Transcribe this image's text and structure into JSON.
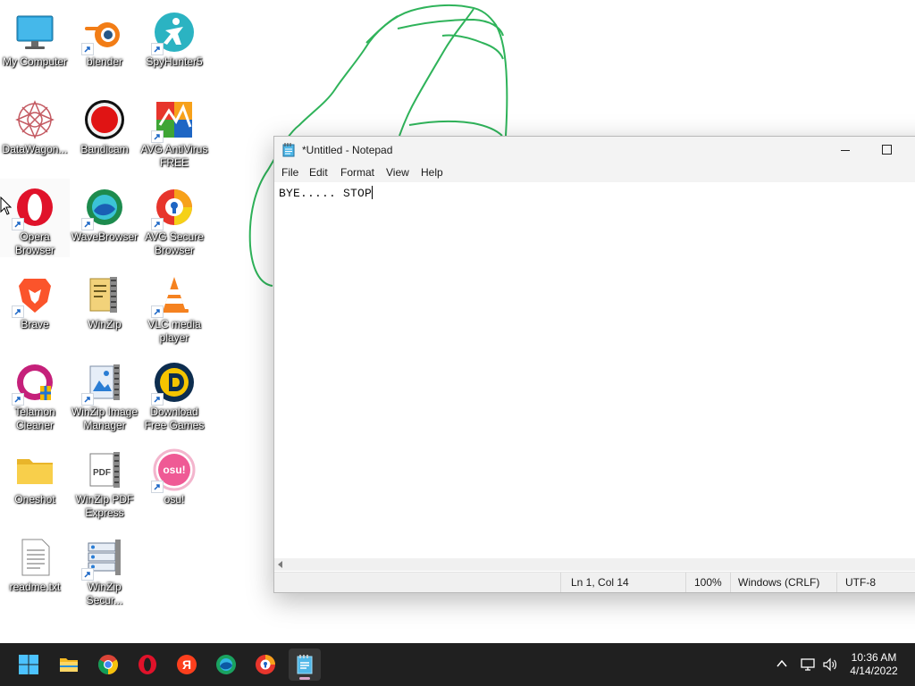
{
  "desktop": {
    "icons": [
      {
        "label": "My Computer"
      },
      {
        "label": "blender"
      },
      {
        "label": "SpyHunter5"
      },
      {
        "label": "DataWagon..."
      },
      {
        "label": "Bandicam"
      },
      {
        "label": "AVG AntiVirus FREE"
      },
      {
        "label": "Opera Browser"
      },
      {
        "label": "WaveBrowser"
      },
      {
        "label": "AVG Secure Browser"
      },
      {
        "label": "Brave"
      },
      {
        "label": "WinZip"
      },
      {
        "label": "VLC media player"
      },
      {
        "label": "Telamon Cleaner"
      },
      {
        "label": "WinZip Image Manager"
      },
      {
        "label": "Download Free Games"
      },
      {
        "label": "Oneshot"
      },
      {
        "label": "WinZip PDF Express"
      },
      {
        "label": "osu!"
      },
      {
        "label": "readme.txt"
      },
      {
        "label": "WinZip Secur..."
      }
    ]
  },
  "notepad": {
    "title": "*Untitled - Notepad",
    "menu": [
      "File",
      "Edit",
      "Format",
      "View",
      "Help"
    ],
    "content": "BYE..... STOP",
    "status": {
      "position": "Ln 1, Col 14",
      "zoom": "100%",
      "line_ending": "Windows (CRLF)",
      "encoding": "UTF-8"
    }
  },
  "taskbar": {
    "apps": [
      "start",
      "file-explorer",
      "chrome",
      "opera",
      "yandex",
      "edge",
      "avg-secure-browser",
      "notepad"
    ],
    "active_app": "notepad",
    "time": "10:36 AM",
    "date": "4/14/2022"
  },
  "colors": {
    "scribble": "#2fb35a",
    "taskbar": "#202020",
    "titlebar": "#f3f3f3",
    "statusbar": "#f0f0f0"
  }
}
